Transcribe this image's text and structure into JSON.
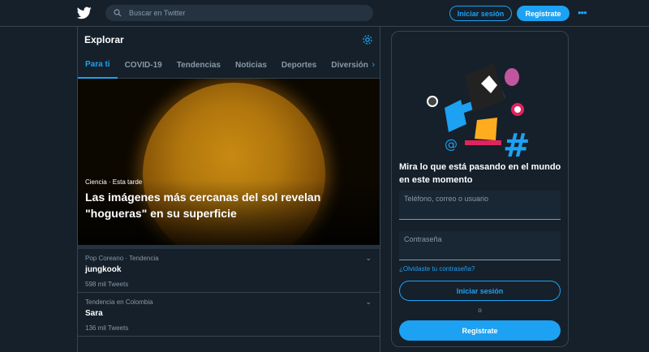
{
  "header": {
    "search_placeholder": "Buscar en Twitter",
    "login_label": "Iniciar sesión",
    "signup_label": "Regístrate",
    "more_label": "•••"
  },
  "explore": {
    "title": "Explorar",
    "tabs": [
      {
        "label": "Para ti",
        "active": true
      },
      {
        "label": "COVID-19"
      },
      {
        "label": "Tendencias"
      },
      {
        "label": "Noticias"
      },
      {
        "label": "Deportes"
      },
      {
        "label": "Diversión"
      }
    ],
    "next_arrow": "›",
    "hero": {
      "meta": "Ciencia · Esta tarde",
      "title": "Las imágenes más cercanas del sol revelan \"hogueras\" en su superficie"
    },
    "trends": [
      {
        "category": "Pop Coreano · Tendencia",
        "name": "jungkook",
        "count": "598 mil Tweets"
      },
      {
        "category": "Tendencia en Colombia",
        "name": "Sara",
        "count": "136 mil Tweets"
      }
    ],
    "chevron": "⌄"
  },
  "signup_panel": {
    "title": "Mira lo que está pasando en el mundo en este momento",
    "phone_label": "Teléfono, correo o usuario",
    "password_label": "Contraseña",
    "forgot_label": "¿Olvidaste tu contraseña?",
    "login_label": "Iniciar sesión",
    "or_label": "o",
    "signup_label": "Regístrate"
  },
  "colors": {
    "background": "#15202b",
    "accent": "#1da1f2",
    "muted": "#8899a6",
    "border": "#38444d"
  }
}
